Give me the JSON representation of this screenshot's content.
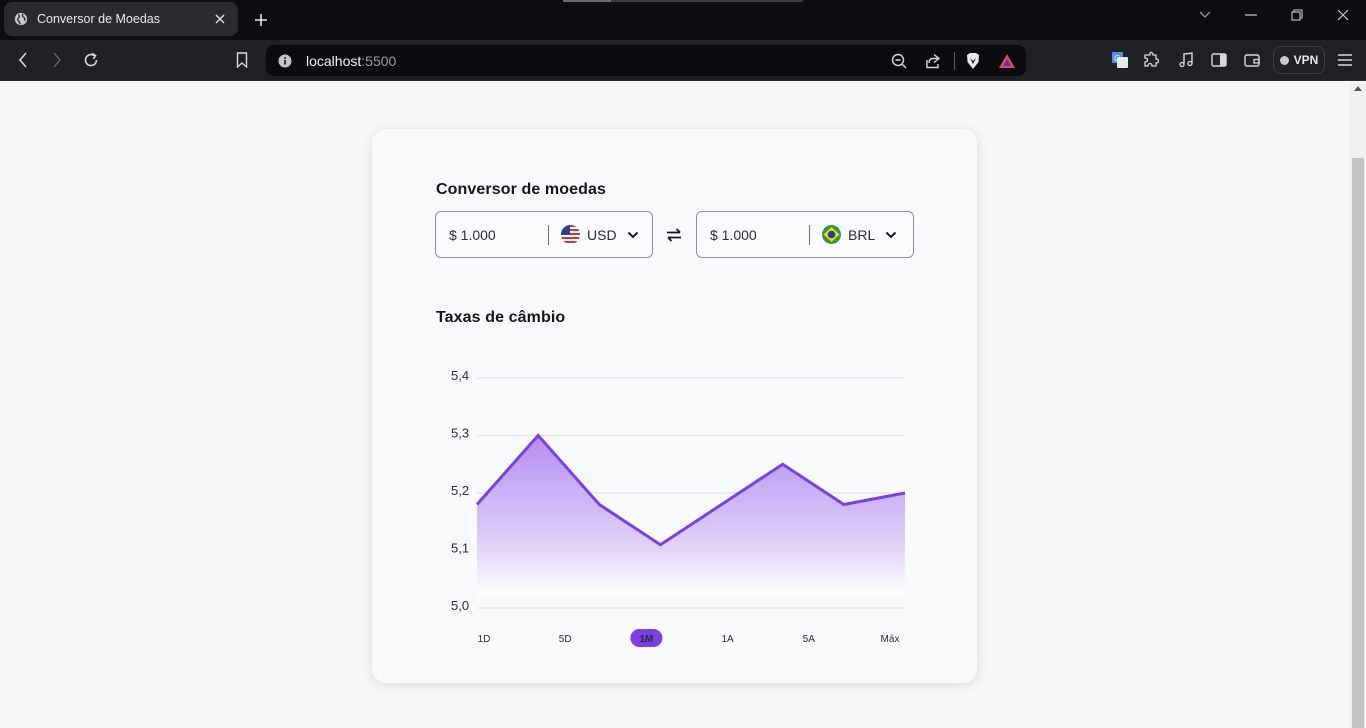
{
  "browser": {
    "tab_title": "Conversor de Moedas",
    "url_host": "localhost",
    "url_port": ":5500",
    "vpn_label": "VPN"
  },
  "converter": {
    "title": "Conversor de moedas",
    "from": {
      "amount": "$ 1.000",
      "code": "USD",
      "flag": "us-flag-icon"
    },
    "to": {
      "amount": "$ 1.000",
      "code": "BRL",
      "flag": "brazil-flag-icon"
    },
    "swap_icon": "swap-arrows-icon"
  },
  "rates": {
    "title": "Taxas de câmbio",
    "ranges": [
      "1D",
      "5D",
      "1M",
      "1A",
      "5A",
      "Máx"
    ],
    "active_range": "1M"
  },
  "colors": {
    "accent": "#7b3fe4",
    "fill_top": "#b38cf2"
  },
  "chart_data": {
    "type": "area",
    "x": [
      0,
      1,
      2,
      3,
      4,
      5,
      6,
      7
    ],
    "series": [
      {
        "values": [
          5.18,
          5.3,
          5.18,
          5.11,
          5.18,
          5.25,
          5.18,
          5.2
        ]
      }
    ],
    "ylim": [
      5.0,
      5.4
    ],
    "yticks": [
      "5,0",
      "5,1",
      "5,2",
      "5,3",
      "5,4"
    ],
    "grid": true,
    "xlabel": "",
    "ylabel": ""
  }
}
